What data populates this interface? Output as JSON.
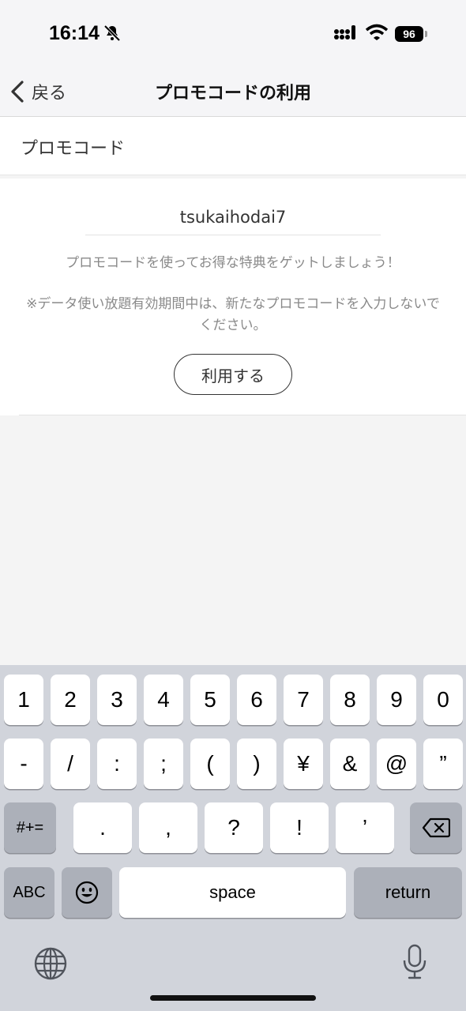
{
  "status": {
    "time": "16:14",
    "battery": "96"
  },
  "nav": {
    "back_label": "戻る",
    "title": "プロモコードの利用"
  },
  "section": {
    "heading": "プロモコード"
  },
  "promo": {
    "code_value": "tsukaihodai7",
    "description": "プロモコードを使ってお得な特典をゲットしましょう！",
    "note": "※データ使い放題有効期間中は、新たなプロモコードを入力しないでください。",
    "use_button": "利用する"
  },
  "keyboard": {
    "row1": [
      "1",
      "2",
      "3",
      "4",
      "5",
      "6",
      "7",
      "8",
      "9",
      "0"
    ],
    "row2": [
      "-",
      "/",
      ":",
      ";",
      "(",
      ")",
      "¥",
      "&",
      "@",
      "”"
    ],
    "row3": {
      "symbols": "#+=",
      "keys": [
        ".",
        ",",
        "?",
        "!",
        "’"
      ]
    },
    "row4": {
      "abc": "ABC",
      "space": "space",
      "return": "return"
    },
    "icons": [
      "bell-slash-icon",
      "signal-icon",
      "wifi-icon",
      "backspace-icon",
      "emoji-icon",
      "globe-icon",
      "microphone-icon"
    ]
  }
}
